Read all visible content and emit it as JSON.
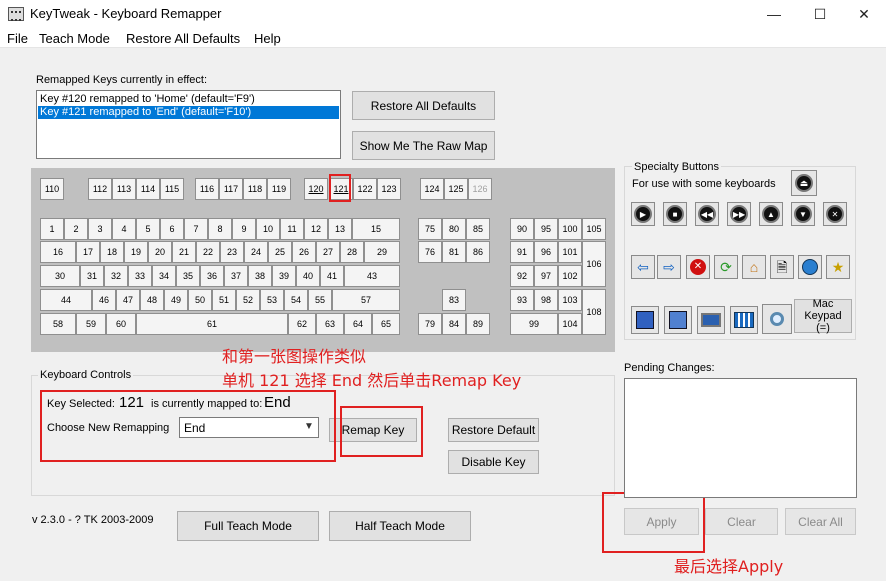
{
  "window": {
    "title": "KeyTweak -  Keyboard Remapper",
    "controls": {
      "minimize": "—",
      "maximize": "☐",
      "close": "✕"
    }
  },
  "menu": [
    "File",
    "Teach Mode",
    "Restore All Defaults",
    "Help"
  ],
  "remapped": {
    "label": "Remapped Keys currently in effect:",
    "items": [
      "Key #120 remapped to 'Home' (default='F9')",
      "Key #121 remapped to 'End' (default='F10')"
    ],
    "selected_index": 1
  },
  "buttons": {
    "restore_all_defaults": "Restore All Defaults",
    "show_raw_map": "Show Me The Raw Map",
    "remap_key": "Remap Key",
    "restore_default": "Restore Default",
    "disable_key": "Disable Key",
    "full_teach": "Full Teach Mode",
    "half_teach": "Half Teach Mode",
    "apply": "Apply",
    "clear": "Clear",
    "clear_all": "Clear All"
  },
  "keyboard": {
    "fkeys": [
      "110",
      "112",
      "113",
      "114",
      "115",
      "116",
      "117",
      "118",
      "119",
      "120",
      "121",
      "122",
      "123",
      "124",
      "125",
      "126"
    ],
    "row1": [
      "1",
      "2",
      "3",
      "4",
      "5",
      "6",
      "7",
      "8",
      "9",
      "10",
      "11",
      "12",
      "13",
      "15"
    ],
    "row2": [
      "16",
      "17",
      "18",
      "19",
      "20",
      "21",
      "22",
      "23",
      "24",
      "25",
      "26",
      "27",
      "28",
      "29"
    ],
    "row3": [
      "30",
      "31",
      "32",
      "33",
      "34",
      "35",
      "36",
      "37",
      "38",
      "39",
      "40",
      "41",
      "43"
    ],
    "row4": [
      "44",
      "46",
      "47",
      "48",
      "49",
      "50",
      "51",
      "52",
      "53",
      "54",
      "55",
      "57"
    ],
    "row5": [
      "58",
      "59",
      "60",
      "61",
      "62",
      "63",
      "64",
      "65"
    ],
    "nav": [
      "75",
      "80",
      "85",
      "76",
      "81",
      "86",
      "83",
      "79",
      "84",
      "89"
    ],
    "numpad": [
      "90",
      "95",
      "100",
      "105",
      "91",
      "96",
      "101",
      "106",
      "92",
      "97",
      "102",
      "93",
      "98",
      "103",
      "108",
      "99",
      "104"
    ]
  },
  "specialty": {
    "title": "Specialty Buttons",
    "subtitle": "For use with some keyboards",
    "mac_keypad": "Mac Keypad (=)",
    "icons": [
      "eject-icon",
      "play-icon",
      "stop-icon",
      "rewind-icon",
      "fast-forward-icon",
      "volume-up-icon",
      "volume-down-icon",
      "mute-icon",
      "back-arrow-icon",
      "forward-arrow-icon",
      "browser-stop-icon",
      "refresh-icon",
      "home-icon",
      "document-icon",
      "web-globe-icon",
      "favorites-icon",
      "mail-icon",
      "media-icon",
      "my-computer-icon",
      "calculator-icon",
      "search-icon"
    ]
  },
  "controls": {
    "title": "Keyboard Controls",
    "key_selected_label": "Key Selected:",
    "key_selected_value": "121",
    "mapped_label": "is currently mapped to:",
    "mapped_value": "End",
    "choose_label": "Choose New Remapping",
    "choose_value": "End"
  },
  "pending": {
    "label": "Pending Changes:"
  },
  "version": "v 2.3.0 - ? TK 2003-2009",
  "annotations": {
    "line1": "和第一张图操作类似",
    "line2": "单机 121   选择 End   然后单击Remap Key",
    "line3": "最后选择Apply"
  },
  "colors": {
    "annotation": "#e02020",
    "selection": "#0078d7",
    "keyboard_bg": "#c0c0c0"
  }
}
